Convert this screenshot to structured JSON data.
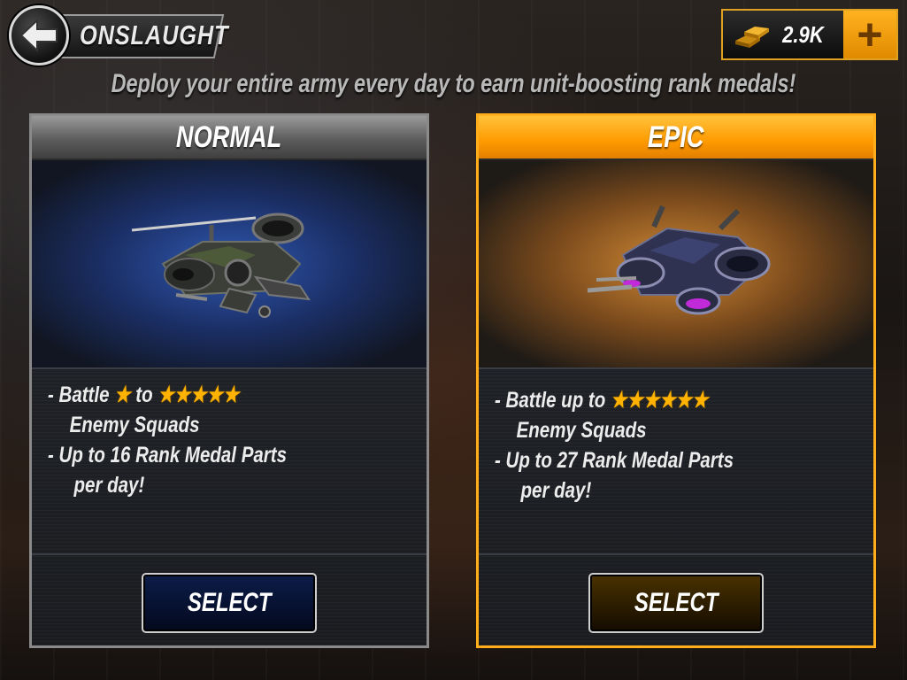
{
  "header": {
    "title": "ONSLAUGHT",
    "subtitle": "Deploy your entire army every day to earn unit-boosting rank medals!",
    "currency_amount": "2.9K",
    "plus_label": "+"
  },
  "cards": [
    {
      "title": "NORMAL",
      "lines": [
        "- Battle",
        "to",
        "Enemy Squads",
        "- Up to 16 Rank Medal Parts",
        "per day!"
      ],
      "star_min": 1,
      "star_max": 5,
      "button_label": "SELECT",
      "accent": "#8a8a8a"
    },
    {
      "title": "EPIC",
      "lines": [
        "- Battle up to",
        "Enemy Squads",
        "- Up to 27 Rank Medal Parts",
        "per day!"
      ],
      "star_max": 6,
      "button_label": "SELECT",
      "accent": "#ffad1a"
    }
  ],
  "icons": {
    "back": "back-arrow-icon",
    "gold": "gold-bars-icon",
    "star": "star-icon"
  }
}
